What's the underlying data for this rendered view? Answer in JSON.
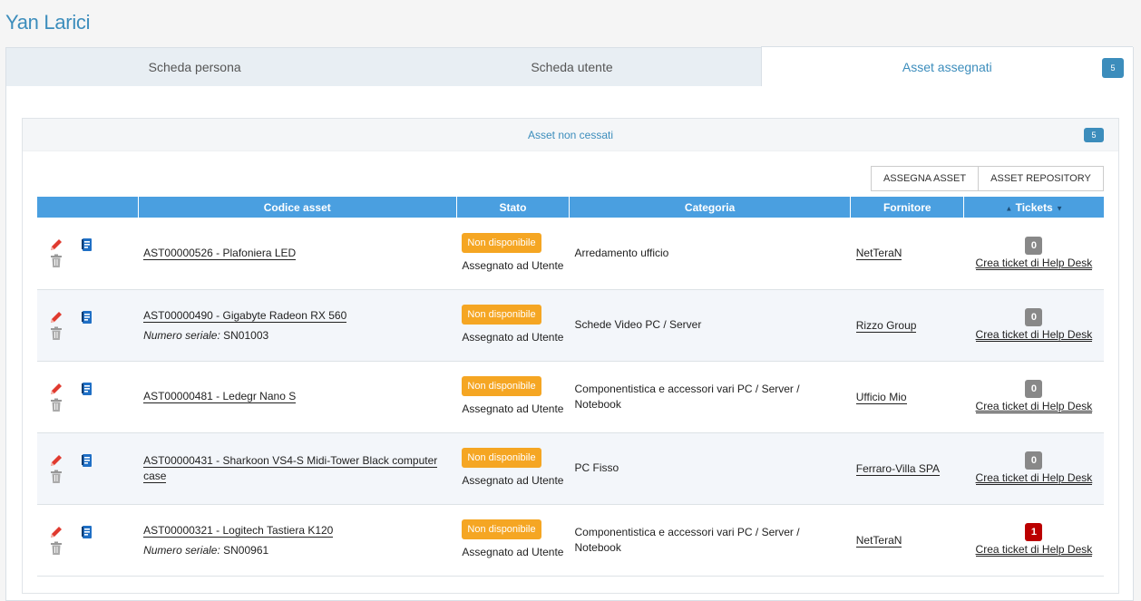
{
  "page": {
    "title": "Yan Larici"
  },
  "tabs": [
    {
      "label": "Scheda persona"
    },
    {
      "label": "Scheda utente"
    },
    {
      "label": "Asset assegnati",
      "badge": "5"
    }
  ],
  "panel": {
    "title": "Asset non cessati",
    "badge": "5"
  },
  "buttons": {
    "assign": "ASSEGNA ASSET",
    "repository": "ASSET REPOSITORY"
  },
  "table": {
    "headers": [
      "",
      "Codice asset",
      "Stato",
      "Categoria",
      "Fornitore",
      "Tickets"
    ],
    "rows": [
      {
        "code": "AST00000526 - Plafoniera LED",
        "serial_label": "",
        "serial": "",
        "status": "Non disponibile",
        "status_detail": "Assegnato ad Utente",
        "category": "Arredamento ufficio",
        "supplier": "NetTeraN",
        "tickets": "0",
        "ticket_link": "Crea ticket di Help Desk"
      },
      {
        "code": "AST00000490 - Gigabyte Radeon RX 560",
        "serial_label": "Numero seriale:",
        "serial": "SN01003",
        "status": "Non disponibile",
        "status_detail": "Assegnato ad Utente",
        "category": "Schede Video PC / Server",
        "supplier": "Rizzo Group",
        "tickets": "0",
        "ticket_link": "Crea ticket di Help Desk"
      },
      {
        "code": "AST00000481 - Ledegr Nano S",
        "serial_label": "",
        "serial": "",
        "status": "Non disponibile",
        "status_detail": "Assegnato ad Utente",
        "category": "Componentistica e accessori vari PC / Server / Notebook",
        "supplier": "Ufficio Mio",
        "tickets": "0",
        "ticket_link": "Crea ticket di Help Desk"
      },
      {
        "code": "AST00000431 - Sharkoon VS4-S Midi-Tower Black computer case",
        "serial_label": "",
        "serial": "",
        "status": "Non disponibile",
        "status_detail": "Assegnato ad Utente",
        "category": "PC Fisso",
        "supplier": "Ferraro-Villa SPA",
        "tickets": "0",
        "ticket_link": "Crea ticket di Help Desk"
      },
      {
        "code": "AST00000321 - Logitech Tastiera K120",
        "serial_label": "Numero seriale:",
        "serial": "SN00961",
        "status": "Non disponibile",
        "status_detail": "Assegnato ad Utente",
        "category": "Componentistica e accessori vari PC / Server / Notebook",
        "supplier": "NetTeraN",
        "tickets": "1",
        "ticket_link": "Crea ticket di Help Desk"
      }
    ]
  },
  "colors": {
    "accent": "#3c8dbc",
    "header": "#4a9fe0",
    "status": "#f5a623",
    "ticket_zero": "#888888",
    "ticket_alert": "#bb0000"
  },
  "icons": {
    "edit": "pencil-icon",
    "detail": "document-icon",
    "delete": "trash-icon"
  }
}
